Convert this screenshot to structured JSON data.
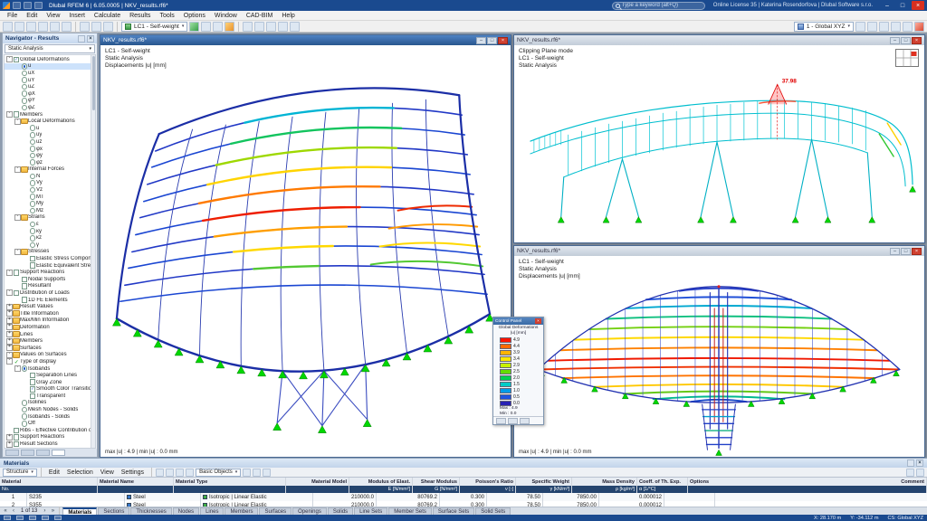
{
  "colors": {
    "titlebar": "#1a4a8f",
    "accent": "#2a6cd4",
    "support_green": "#00d800",
    "annotation_red": "#e00000"
  },
  "icons": {
    "minimize": "–",
    "maximize": "□",
    "close": "×",
    "dropdown": "▾",
    "first": "«",
    "prev": "‹",
    "next": "›",
    "last": "»"
  },
  "titlebar": {
    "app_title": "Dlubal RFEM 6 | 6.05.0005 | NKV_results.rf6*",
    "search_placeholder": "Type a keyword (alt+Q)",
    "license": "Online License 35 | Katerina Rosendorfova | Dlubal Software s.r.o."
  },
  "menubar": {
    "items": [
      "File",
      "Edit",
      "View",
      "Insert",
      "Calculate",
      "Results",
      "Tools",
      "Options",
      "Window",
      "CAD-BIM",
      "Help"
    ]
  },
  "toolbar": {
    "load_case": "LC1 - Self-weight",
    "view": "1 - Global XYZ"
  },
  "navigator": {
    "title": "Navigator - Results",
    "analysis": "Static Analysis",
    "items": [
      {
        "level": 0,
        "ctl": "cb1",
        "exp": "-",
        "label": "Global Deformations"
      },
      {
        "level": 1,
        "ctl": "ron",
        "state": "sel",
        "label": "u"
      },
      {
        "level": 1,
        "ctl": "roff",
        "label": "uX"
      },
      {
        "level": 1,
        "ctl": "roff",
        "label": "uY"
      },
      {
        "level": 1,
        "ctl": "roff",
        "label": "uZ"
      },
      {
        "level": 1,
        "ctl": "roff",
        "label": "φX"
      },
      {
        "level": 1,
        "ctl": "roff",
        "label": "φY"
      },
      {
        "level": 1,
        "ctl": "roff",
        "label": "φZ"
      },
      {
        "level": 0,
        "ctl": "cb0",
        "exp": "-",
        "label": "Members"
      },
      {
        "level": 1,
        "ctl": "fold",
        "exp": "-",
        "label": "Local Deformations"
      },
      {
        "level": 2,
        "ctl": "roff",
        "label": "u"
      },
      {
        "level": 2,
        "ctl": "roff",
        "label": "uy"
      },
      {
        "level": 2,
        "ctl": "roff",
        "label": "uz"
      },
      {
        "level": 2,
        "ctl": "roff",
        "label": "φx"
      },
      {
        "level": 2,
        "ctl": "roff",
        "label": "φy"
      },
      {
        "level": 2,
        "ctl": "roff",
        "label": "φz"
      },
      {
        "level": 1,
        "ctl": "fold",
        "exp": "-",
        "label": "Internal Forces"
      },
      {
        "level": 2,
        "ctl": "roff",
        "label": "N"
      },
      {
        "level": 2,
        "ctl": "roff",
        "label": "Vy"
      },
      {
        "level": 2,
        "ctl": "roff",
        "label": "Vz"
      },
      {
        "level": 2,
        "ctl": "roff",
        "label": "MT"
      },
      {
        "level": 2,
        "ctl": "roff",
        "label": "My"
      },
      {
        "level": 2,
        "ctl": "roff",
        "label": "Mz"
      },
      {
        "level": 1,
        "ctl": "fold",
        "exp": "-",
        "label": "Strains"
      },
      {
        "level": 2,
        "ctl": "roff",
        "label": "ε"
      },
      {
        "level": 2,
        "ctl": "roff",
        "label": "κy"
      },
      {
        "level": 2,
        "ctl": "roff",
        "label": "κz"
      },
      {
        "level": 2,
        "ctl": "roff",
        "label": "γ"
      },
      {
        "level": 1,
        "ctl": "fold",
        "exp": "-",
        "label": "Stresses"
      },
      {
        "level": 2,
        "ctl": "cb0",
        "label": "Elastic Stress Components"
      },
      {
        "level": 2,
        "ctl": "cb0",
        "label": "Elastic Equivalent Stress"
      },
      {
        "level": 0,
        "ctl": "cb0",
        "exp": "-",
        "label": "Support Reactions"
      },
      {
        "level": 1,
        "ctl": "cb0",
        "label": "Nodal Supports"
      },
      {
        "level": 1,
        "ctl": "cb0",
        "label": "Resultant"
      },
      {
        "level": 0,
        "ctl": "cb0",
        "exp": "-",
        "label": "Distribution of Loads"
      },
      {
        "level": 1,
        "ctl": "cb0",
        "label": "1D FE Elements"
      },
      {
        "level": 0,
        "ctl": "fold",
        "exp": "+",
        "label": "Result Values"
      },
      {
        "level": 0,
        "ctl": "fold",
        "exp": "+",
        "label": "Title Information"
      },
      {
        "level": 0,
        "ctl": "fold",
        "exp": "+",
        "label": "Max/Min Information"
      },
      {
        "level": 0,
        "ctl": "fold",
        "exp": "+",
        "label": "Deformation"
      },
      {
        "level": 0,
        "ctl": "fold",
        "exp": "+",
        "label": "Lines"
      },
      {
        "level": 0,
        "ctl": "fold",
        "exp": "+",
        "label": "Members"
      },
      {
        "level": 0,
        "ctl": "fold",
        "exp": "+",
        "label": "Surfaces"
      },
      {
        "level": 0,
        "ctl": "fold",
        "exp": "-",
        "label": "Values on Surfaces"
      },
      {
        "level": 0,
        "ctl": "chk",
        "exp": "-",
        "label": "Type of display"
      },
      {
        "level": 1,
        "ctl": "ron",
        "exp": "-",
        "label": "Isobands"
      },
      {
        "level": 2,
        "ctl": "cb0",
        "label": "Separation Lines"
      },
      {
        "level": 2,
        "ctl": "cb0",
        "label": "Gray Zone"
      },
      {
        "level": 2,
        "ctl": "cb1",
        "label": "Smooth Color Transition"
      },
      {
        "level": 2,
        "ctl": "cb0",
        "label": "Transparent"
      },
      {
        "level": 1,
        "ctl": "roff",
        "label": "Isolines"
      },
      {
        "level": 1,
        "ctl": "roff",
        "label": "Mesh Nodes - Solids"
      },
      {
        "level": 1,
        "ctl": "roff",
        "label": "Isobands - Solids"
      },
      {
        "level": 1,
        "ctl": "roff",
        "label": "Off"
      },
      {
        "level": 0,
        "ctl": "cb0",
        "label": "Ribs - Effective Contribution on Surf..."
      },
      {
        "level": 0,
        "ctl": "cb0",
        "exp": "+",
        "label": "Support Reactions"
      },
      {
        "level": 0,
        "ctl": "cb0",
        "exp": "+",
        "label": "Result Sections"
      }
    ]
  },
  "windows": {
    "main": {
      "title": "NKV_results.rf6*",
      "info1": "LC1 - Self-weight",
      "info2": "Static Analysis",
      "info3": "Displacements |u| [mm]",
      "status": "max |u| : 4.9 | min |u| : 0.0 mm"
    },
    "top_right": {
      "title": "NKV_results.rf6*",
      "info1": "Clipping Plane mode",
      "info2": "LC1 - Self-weight",
      "info3": "Static Analysis",
      "annotation": "37.98"
    },
    "bottom_right": {
      "title": "NKV_results.rf6*",
      "info1": "LC1 - Self-weight",
      "info2": "Static Analysis",
      "info3": "Displacements |u| [mm]",
      "status": "max |u| : 4.9 | min |u| : 0.0 mm"
    }
  },
  "legend": {
    "window_title": "Control Panel",
    "head1": "Global Deformations",
    "head2": "|u| [mm]",
    "entries": [
      {
        "color": "#ff1400",
        "value": "4.9"
      },
      {
        "color": "#ff6a00",
        "value": "4.4"
      },
      {
        "color": "#ffb400",
        "value": "3.9"
      },
      {
        "color": "#ffe800",
        "value": "3.4"
      },
      {
        "color": "#c8f000",
        "value": "2.9"
      },
      {
        "color": "#64dc00",
        "value": "2.5"
      },
      {
        "color": "#00d050",
        "value": "2.0"
      },
      {
        "color": "#00ccc8",
        "value": "1.5"
      },
      {
        "color": "#009ce8",
        "value": "1.0"
      },
      {
        "color": "#2054e0",
        "value": "0.5"
      },
      {
        "color": "#2822b4",
        "value": "0.0"
      }
    ],
    "max_label": "Max : 4.9",
    "min_label": "Min : 0.0"
  },
  "materials": {
    "panel_title": "Materials",
    "menu_items": [
      "Edit",
      "Selection",
      "View",
      "Settings"
    ],
    "scope": "Structure",
    "filter": "Basic Objects",
    "columns": [
      {
        "label": "Material",
        "unit": "No."
      },
      {
        "label": "Material Name",
        "unit": ""
      },
      {
        "label": "Material Type",
        "unit": ""
      },
      {
        "label": "Material Model",
        "unit": ""
      },
      {
        "label": "Modulus of Elast.",
        "unit": "E [N/mm²]"
      },
      {
        "label": "Shear Modulus",
        "unit": "G [N/mm²]"
      },
      {
        "label": "Poisson's Ratio",
        "unit": "ν [-]"
      },
      {
        "label": "Specific Weight",
        "unit": "γ [kN/m³]"
      },
      {
        "label": "Mass Density",
        "unit": "ρ [kg/m³]"
      },
      {
        "label": "Coeff. of Th. Exp.",
        "unit": "α [1/°C]"
      },
      {
        "label": "Options",
        "unit": ""
      },
      {
        "label": "Comment",
        "unit": ""
      }
    ],
    "rows": [
      {
        "no": "1",
        "name": "S235",
        "type": "Steel",
        "model": "Isotropic | Linear Elastic",
        "e": "210000.0",
        "g": "80769.2",
        "nu": "0.300",
        "gamma": "78.50",
        "rho": "7850.00",
        "alpha": "0.000012",
        "options": "",
        "comment": ""
      },
      {
        "no": "2",
        "name": "S355",
        "type": "Steel",
        "model": "Isotropic | Linear Elastic",
        "e": "210000.0",
        "g": "80769.2",
        "nu": "0.300",
        "gamma": "78.50",
        "rho": "7850.00",
        "alpha": "0.000012",
        "options": "",
        "comment": ""
      }
    ],
    "pager": "1 of 13",
    "tabs": [
      {
        "label": "Materials",
        "state": "active"
      },
      {
        "label": "Sections"
      },
      {
        "label": "Thicknesses"
      },
      {
        "label": "Nodes"
      },
      {
        "label": "Lines"
      },
      {
        "label": "Members"
      },
      {
        "label": "Surfaces"
      },
      {
        "label": "Openings"
      },
      {
        "label": "Solids"
      },
      {
        "label": "Line Sets"
      },
      {
        "label": "Member Sets"
      },
      {
        "label": "Surface Sets"
      },
      {
        "label": "Solid Sets"
      }
    ]
  },
  "statusbar": {
    "x": "X: 28.170 m",
    "y": "Y: -34.112 m",
    "cs": "CS: Global XYZ"
  }
}
